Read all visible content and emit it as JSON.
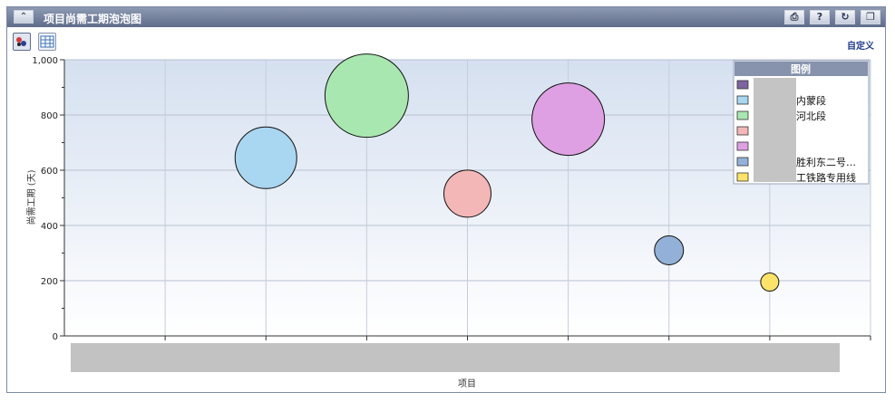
{
  "window": {
    "title": "项目尚需工期泡泡图",
    "customize_label": "自定义",
    "icons": [
      "collapse-icon",
      "print-icon",
      "help-icon",
      "refresh-icon",
      "restore-icon",
      "bubble-chart-view-icon",
      "table-view-icon"
    ],
    "help_label": "?"
  },
  "chart_data": {
    "type": "scatter",
    "subtype": "bubble",
    "title": "",
    "xlabel": "项目",
    "ylabel": "尚需工期 (天)",
    "ylim": [
      0,
      1000
    ],
    "yticks": [
      "0",
      "200",
      "400",
      "600",
      "800",
      "1,000"
    ],
    "x_categories": 8,
    "x_tick_labels_hidden": true,
    "grid": true,
    "legend_position": "top-right",
    "legend_title": "图例",
    "series": [
      {
        "name": "",
        "x": 1,
        "y": 0,
        "size": 0,
        "color": "#7e64a0"
      },
      {
        "name": "内蒙段",
        "x": 2,
        "y": 645,
        "size": 34,
        "color": "#a9d6f0"
      },
      {
        "name": "河北段",
        "x": 3,
        "y": 870,
        "size": 46,
        "color": "#a9e7b0"
      },
      {
        "name": "",
        "x": 4,
        "y": 515,
        "size": 26,
        "color": "#f3b7b7"
      },
      {
        "name": "",
        "x": 5,
        "y": 785,
        "size": 40,
        "color": "#dea0e3"
      },
      {
        "name": "胜利东二号…",
        "x": 6,
        "y": 310,
        "size": 16,
        "color": "#93b1d8"
      },
      {
        "name": "工铁路专用线",
        "x": 7,
        "y": 195,
        "size": 10,
        "color": "#fde36a"
      }
    ]
  }
}
